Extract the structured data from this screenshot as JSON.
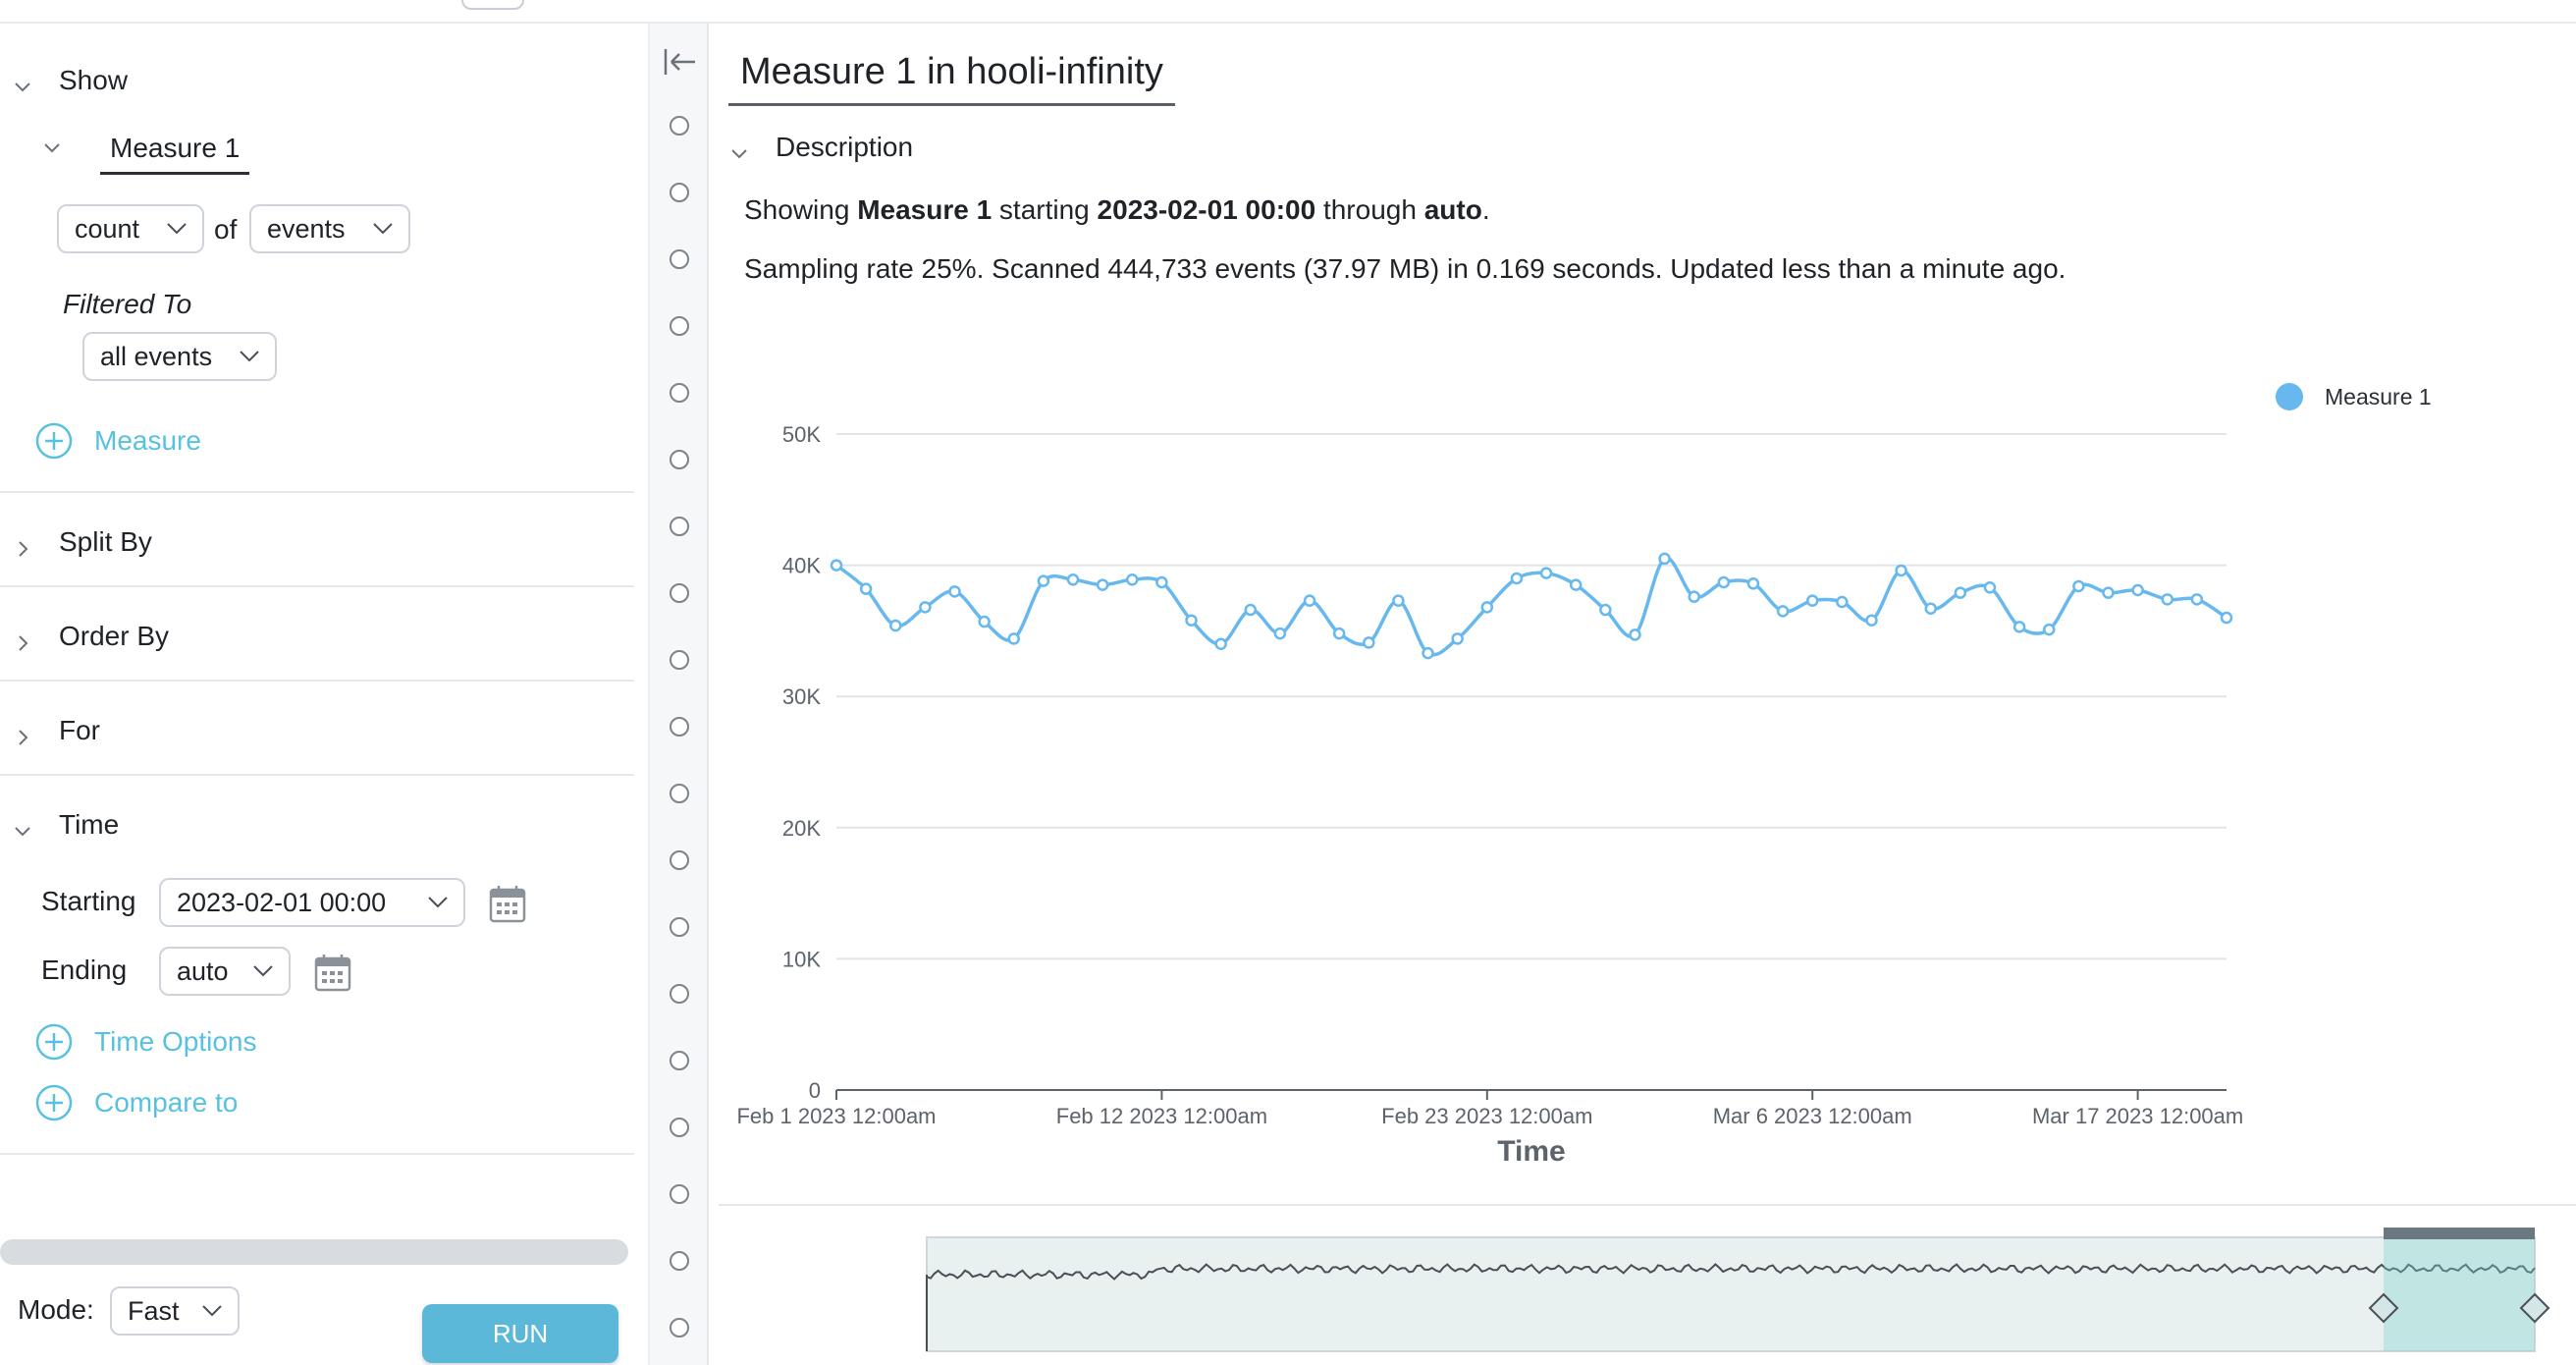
{
  "colors": {
    "accent": "#58c1e0",
    "series": "#66b8ee",
    "run_button": "#5bb8d8"
  },
  "left_panel": {
    "show": {
      "label": "Show"
    },
    "measure_tab": "Measure 1",
    "aggregation": "count",
    "of_label": "of",
    "event_type": "events",
    "filtered_to_label": "Filtered To",
    "filter_value": "all events",
    "add_measure": "Measure",
    "sections": {
      "split_by": "Split By",
      "order_by": "Order By",
      "for": "For",
      "time": "Time"
    },
    "time": {
      "starting_label": "Starting",
      "starting_value": "2023-02-01 00:00",
      "ending_label": "Ending",
      "ending_value": "auto",
      "time_options": "Time Options",
      "compare_to": "Compare to"
    },
    "mode_label": "Mode:",
    "mode_value": "Fast",
    "run_label": "RUN"
  },
  "main": {
    "title": "Measure 1 in hooli-infinity",
    "description_label": "Description",
    "summary": {
      "prefix": "Showing ",
      "measure": "Measure 1",
      "mid1": " starting ",
      "start": "2023-02-01 00:00",
      "mid2": " through ",
      "end": "auto",
      "suffix": "."
    },
    "sampling": "Sampling rate 25%. Scanned 444,733 events (37.97 MB) in 0.169 seconds. Updated less than a minute ago."
  },
  "chart_data": {
    "type": "line",
    "xlabel": "Time",
    "ylabel": "",
    "ylim": [
      0,
      50000
    ],
    "yticks": [
      0,
      10000,
      20000,
      30000,
      40000,
      50000
    ],
    "ytick_labels": [
      "0",
      "10K",
      "20K",
      "30K",
      "40K",
      "50K"
    ],
    "x_tick_labels": [
      "Feb 1 2023 12:00am",
      "Feb 12 2023 12:00am",
      "Feb 23 2023 12:00am",
      "Mar 6 2023 12:00am",
      "Mar 17 2023 12:00am"
    ],
    "x_tick_days": [
      0,
      11,
      22,
      33,
      44
    ],
    "grid": true,
    "legend_position": "top-right",
    "series": [
      {
        "name": "Measure 1",
        "x_days": [
          0,
          1,
          2,
          3,
          4,
          5,
          6,
          7,
          8,
          9,
          10,
          11,
          12,
          13,
          14,
          15,
          16,
          17,
          18,
          19,
          20,
          21,
          22,
          23,
          24,
          25,
          26,
          27,
          28,
          29,
          30,
          31,
          32,
          33,
          34,
          35,
          36,
          37,
          38,
          39,
          40,
          41,
          42,
          43,
          44,
          45,
          46,
          47
        ],
        "values": [
          40000,
          38200,
          35400,
          36800,
          38000,
          35700,
          34400,
          38800,
          38900,
          38500,
          38900,
          38700,
          35800,
          34000,
          36600,
          34800,
          37300,
          34800,
          34100,
          37300,
          33300,
          34400,
          36800,
          39000,
          39400,
          38500,
          36600,
          34700,
          40500,
          37600,
          38700,
          38600,
          36500,
          37300,
          37200,
          35800,
          39600,
          36700,
          37900,
          38300,
          35300,
          35100,
          38400,
          37900,
          38100,
          37400,
          37400,
          36000
        ]
      }
    ],
    "navigator": {
      "visible": true,
      "selection": "end"
    }
  }
}
